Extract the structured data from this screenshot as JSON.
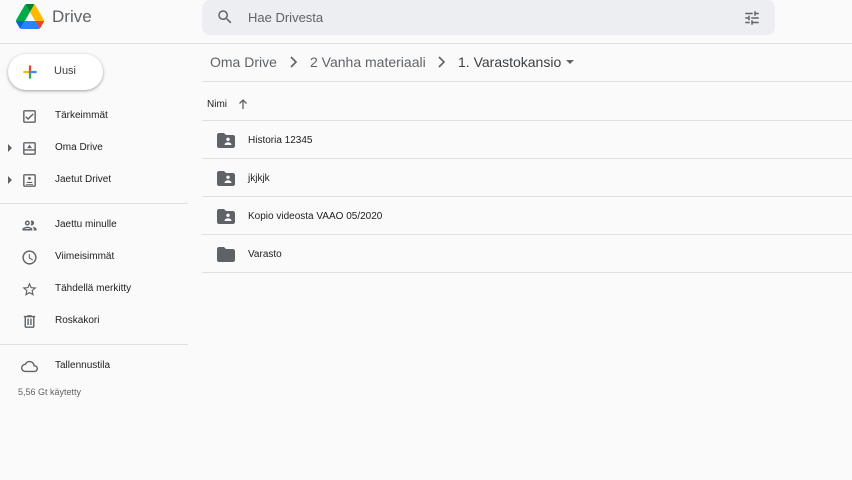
{
  "app": {
    "title": "Drive",
    "logo_icon": "google-drive-logo"
  },
  "search": {
    "placeholder": "Hae Drivesta",
    "value": "",
    "icon": "search-icon",
    "options_icon": "tune-icon"
  },
  "new_button": {
    "label": "Uusi",
    "icon": "plus-icon"
  },
  "sidebar": {
    "items": [
      {
        "label": "Tärkeimmät",
        "icon": "checkbox-icon",
        "expandable": false
      },
      {
        "label": "Oma Drive",
        "icon": "my-drive-icon",
        "expandable": true
      },
      {
        "label": "Jaetut Drivet",
        "icon": "shared-drives-icon",
        "expandable": true
      },
      {
        "label": "Jaettu minulle",
        "icon": "people-icon",
        "expandable": false
      },
      {
        "label": "Viimeisimmät",
        "icon": "clock-icon",
        "expandable": false
      },
      {
        "label": "Tähdellä merkitty",
        "icon": "star-icon",
        "expandable": false
      },
      {
        "label": "Roskakori",
        "icon": "trash-icon",
        "expandable": false
      }
    ],
    "storage": {
      "label": "Tallennustila",
      "icon": "cloud-icon",
      "usage_text": "5,56 Gt käytetty"
    }
  },
  "breadcrumb": {
    "items": [
      "Oma Drive",
      "2 Vanha materiaali",
      "1. Varastokansio"
    ],
    "separator_icon": "chevron-right-icon",
    "dropdown_icon": "caret-down-icon"
  },
  "list": {
    "sort_column": "Nimi",
    "sort_direction": "ascending",
    "sort_icon": "arrow-up-icon",
    "folders": [
      {
        "name": "Historia 12345",
        "icon": "shared-folder-icon"
      },
      {
        "name": "jkjkjk",
        "icon": "shared-folder-icon"
      },
      {
        "name": "Kopio videosta VAAO 05/2020",
        "icon": "shared-folder-icon"
      },
      {
        "name": "Varasto",
        "icon": "folder-icon"
      }
    ]
  },
  "colors": {
    "background": "#fafafa",
    "search_bg": "#eceef1",
    "icon_gray": "#5f6368",
    "divider": "#e0e0e0"
  }
}
